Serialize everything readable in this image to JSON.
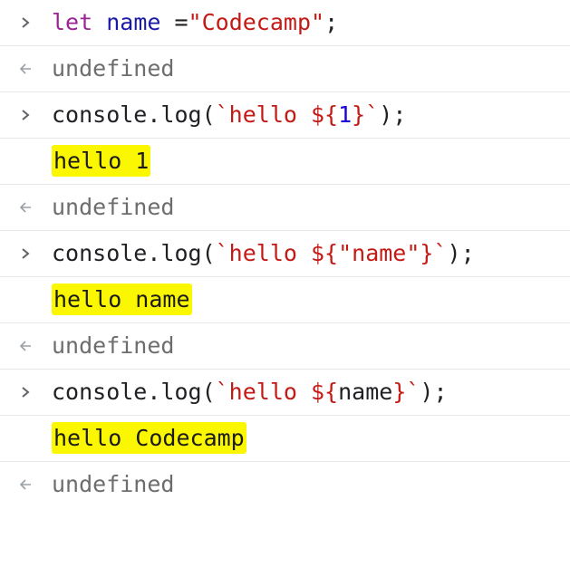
{
  "console": {
    "rows": [
      {
        "type": "input",
        "prompt_icon": "chevron-right-icon",
        "tokens": [
          {
            "text": "let",
            "role": "keyword"
          },
          {
            "text": " ",
            "role": "plain"
          },
          {
            "text": "name",
            "role": "variable"
          },
          {
            "text": " =",
            "role": "plain"
          },
          {
            "text": "\"Codecamp\"",
            "role": "string"
          },
          {
            "text": ";",
            "role": "plain"
          }
        ]
      },
      {
        "type": "result",
        "prompt_icon": "return-arrow-icon",
        "text": "undefined"
      },
      {
        "type": "input",
        "prompt_icon": "chevron-right-icon",
        "tokens": [
          {
            "text": "console.log(",
            "role": "plain"
          },
          {
            "text": "`hello ${",
            "role": "string"
          },
          {
            "text": "1",
            "role": "number"
          },
          {
            "text": "}`",
            "role": "string"
          },
          {
            "text": ");",
            "role": "plain"
          }
        ]
      },
      {
        "type": "output",
        "text": "hello 1",
        "highlighted": true
      },
      {
        "type": "result",
        "prompt_icon": "return-arrow-icon",
        "text": "undefined"
      },
      {
        "type": "input",
        "prompt_icon": "chevron-right-icon",
        "tokens": [
          {
            "text": "console.log(",
            "role": "plain"
          },
          {
            "text": "`hello ${",
            "role": "string"
          },
          {
            "text": "\"name\"",
            "role": "string"
          },
          {
            "text": "}`",
            "role": "string"
          },
          {
            "text": ");",
            "role": "plain"
          }
        ]
      },
      {
        "type": "output",
        "text": "hello name",
        "highlighted": true
      },
      {
        "type": "result",
        "prompt_icon": "return-arrow-icon",
        "text": "undefined"
      },
      {
        "type": "input",
        "prompt_icon": "chevron-right-icon",
        "tokens": [
          {
            "text": "console.log(",
            "role": "plain"
          },
          {
            "text": "`hello ${",
            "role": "string"
          },
          {
            "text": "name",
            "role": "plain"
          },
          {
            "text": "}`",
            "role": "string"
          },
          {
            "text": ");",
            "role": "plain"
          }
        ]
      },
      {
        "type": "output",
        "text": "hello Codecamp",
        "highlighted": true
      },
      {
        "type": "result",
        "prompt_icon": "return-arrow-icon",
        "text": "undefined"
      }
    ]
  },
  "colors": {
    "keyword": "#9b2393",
    "variable": "#1a1aa6",
    "string": "#c41a16",
    "number": "#1c00cf",
    "undefined": "#6d6d6d",
    "highlight": "#fbf700",
    "divider": "#e6e6e6"
  }
}
